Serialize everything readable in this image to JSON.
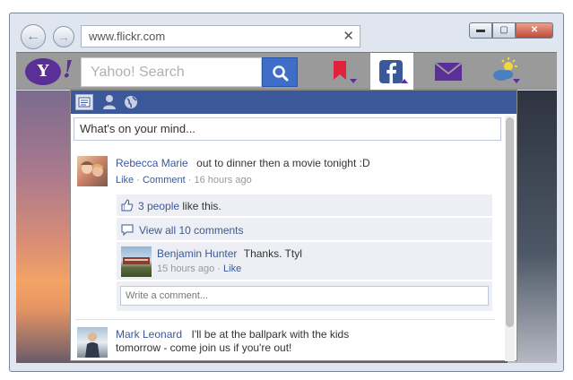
{
  "browser": {
    "address": "www.flickr.com",
    "back_glyph": "←",
    "forward_glyph": "→",
    "clear_glyph": "✕",
    "minimize_glyph": "▬",
    "maximize_glyph": "▢",
    "close_glyph": "✕"
  },
  "toolbar": {
    "logo_text": "Y",
    "logo_exclaim": "!",
    "search_placeholder": "Yahoo! Search",
    "icons": [
      "bookmark-icon",
      "facebook-icon",
      "mail-icon",
      "weather-icon"
    ],
    "colors": {
      "yahoo_purple": "#5b2f98",
      "search_blue": "#3e6ec8",
      "bookmark_red": "#e0223d",
      "facebook_blue": "#3b5998"
    }
  },
  "facebook": {
    "status_placeholder": "What's on your mind...",
    "posts": [
      {
        "author": "Rebecca Marie",
        "text": "out to dinner then a movie tonight :D",
        "like": "Like",
        "sep": "·",
        "comment": "Comment",
        "time": "16 hours ago",
        "likes_link": "3 people",
        "likes_suffix": "like this.",
        "view_comments": "View all 10 comments",
        "comments": [
          {
            "author": "Benjamin Hunter",
            "text": "Thanks. Ttyl",
            "time": "15 hours ago",
            "sep": "·",
            "like": "Like"
          }
        ],
        "write_placeholder": "Write a comment..."
      },
      {
        "author": "Mark Leonard",
        "text_line1": "I'll be at the ballpark with the kids",
        "text_line2": "tomorrow - come join us if you're out!"
      }
    ]
  }
}
